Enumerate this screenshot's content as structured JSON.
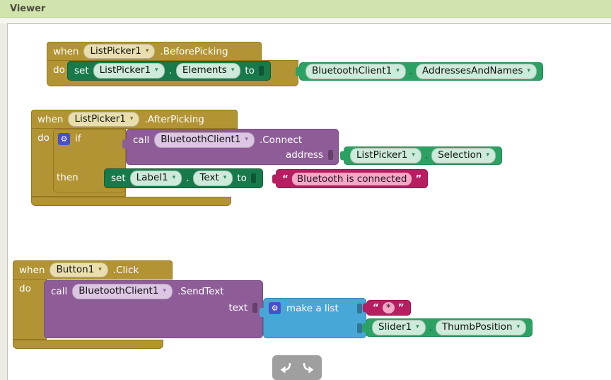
{
  "header": {
    "title": "Viewer"
  },
  "icons": {
    "dropdown": "▾",
    "gear": "⚙"
  },
  "groups": {
    "before_picking": {
      "when": "when",
      "component": "ListPicker1",
      "event": ".BeforePicking",
      "do_label": "do",
      "set": {
        "kw": "set",
        "component": "ListPicker1",
        "dot": ".",
        "property": "Elements",
        "to": "to"
      },
      "value": {
        "component": "BluetoothClient1",
        "dot": ".",
        "property": "AddressesAndNames"
      }
    },
    "after_picking": {
      "when": "when",
      "component": "ListPicker1",
      "event": ".AfterPicking",
      "do_label": "do",
      "if_label": "if",
      "then_label": "then",
      "call": {
        "kw": "call",
        "component": "BluetoothClient1",
        "method": ".Connect",
        "arg_label": "address"
      },
      "arg_value": {
        "component": "ListPicker1",
        "dot": ".",
        "property": "Selection"
      },
      "set": {
        "kw": "set",
        "component": "Label1",
        "dot": ".",
        "property": "Text",
        "to": "to"
      },
      "string_value": {
        "open_quote": "“",
        "text": "Bluetooth is connected",
        "close_quote": "”"
      }
    },
    "button_click": {
      "when": "when",
      "component": "Button1",
      "event": ".Click",
      "do_label": "do",
      "call": {
        "kw": "call",
        "component": "BluetoothClient1",
        "method": ".SendText",
        "arg_label": "text"
      },
      "make_list": {
        "label": "make a list"
      },
      "item_string": {
        "open_quote": "“",
        "text": "*",
        "close_quote": "”"
      },
      "item_value": {
        "component": "Slider1",
        "dot": ".",
        "property": "ThumbPosition"
      }
    }
  },
  "colors": {
    "header_bg": "#d2e4ae",
    "event_gold": "#b29434",
    "setter_green": "#187a4b",
    "getter_green": "#2ba263",
    "call_purple": "#8e5d98",
    "string_magenta": "#b71e61",
    "list_blue": "#47a8d8",
    "gear_badge": "#4a4fc8",
    "string_field_pink": "#f4a8c5"
  }
}
